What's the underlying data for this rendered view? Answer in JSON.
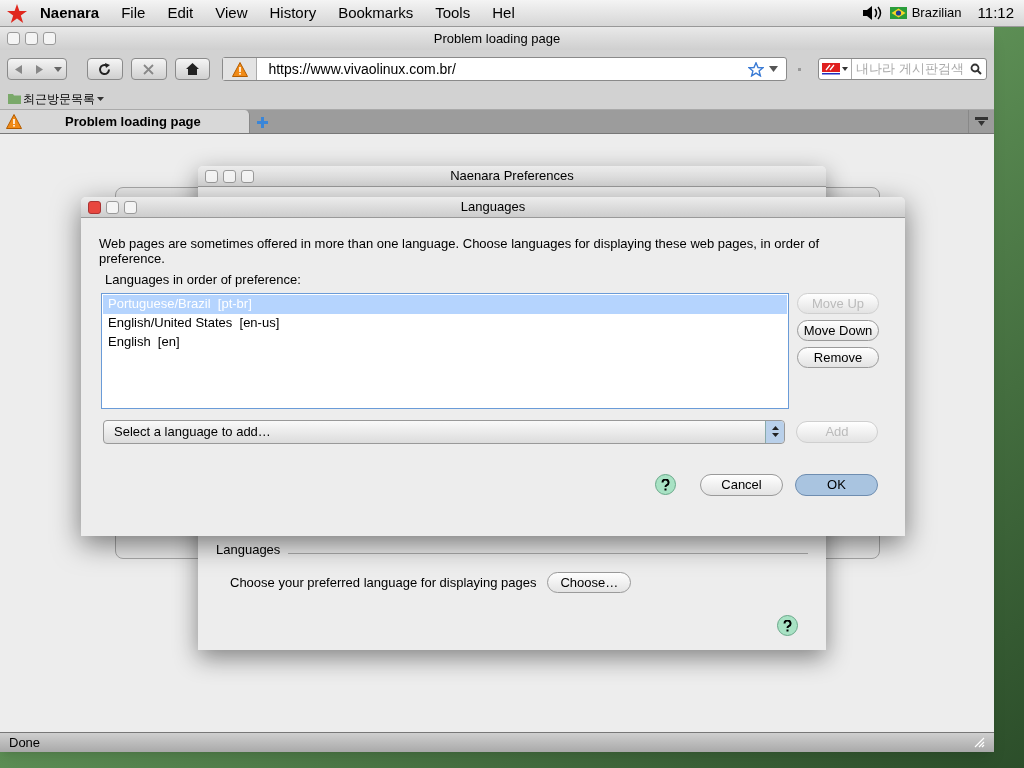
{
  "menubar": {
    "app_name": "Naenara",
    "menus": [
      "File",
      "Edit",
      "View",
      "History",
      "Bookmarks",
      "Tools",
      "Hel"
    ],
    "input_source": "Brazilian",
    "clock": "11:12"
  },
  "browser": {
    "title": "Problem loading page",
    "url": "https://www.vivaolinux.com.br/",
    "search_placeholder": "내나라 게시판검색",
    "bookmarks": [
      "최근방문목록"
    ],
    "tabs": [
      {
        "label": "Problem loading page",
        "selected": true
      }
    ],
    "status": "Done"
  },
  "preferences": {
    "title": "Naenara Preferences",
    "section": "Languages",
    "description": "Choose your preferred language for displaying pages",
    "choose_button": "Choose…"
  },
  "languages_dialog": {
    "title": "Languages",
    "intro": "Web pages are sometimes offered in more than one language. Choose languages for displaying these web pages, in order of preference.",
    "list_label": "Languages in order of preference:",
    "items": [
      {
        "label": "Portuguese/Brazil  [pt-br]",
        "selected": true
      },
      {
        "label": "English/United States  [en-us]",
        "selected": false
      },
      {
        "label": "English  [en]",
        "selected": false
      }
    ],
    "side_buttons": [
      {
        "label": "Move Up",
        "disabled": true
      },
      {
        "label": "Move Down",
        "disabled": false
      },
      {
        "label": "Remove",
        "disabled": false
      }
    ],
    "select_placeholder": "Select a language to add…",
    "add_button": {
      "label": "Add",
      "disabled": true
    },
    "cancel": "Cancel",
    "ok": "OK"
  }
}
